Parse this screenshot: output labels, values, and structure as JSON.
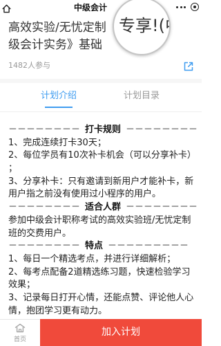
{
  "nav": {
    "title": "中级会计"
  },
  "magnifier": {
    "text": "专享!(中"
  },
  "course": {
    "title_lines": [
      "高效实验/无忧定制",
      "级会计实务》基础"
    ],
    "participants": "1482人参与"
  },
  "tabs": [
    {
      "label": "计划介绍",
      "active": true
    },
    {
      "label": "计划目录",
      "active": false
    }
  ],
  "content": {
    "rules_divider": {
      "left": "－－－－－－－－",
      "label": "打卡规则",
      "right": "－－－－－－－－"
    },
    "rules": [
      "1、完成连续打卡30天；",
      "2、每位学员有10次补卡机会（可以分享补卡）",
      "；",
      "3、分享补卡：只有邀请到新用户才能补卡，新",
      "用户指之前没有使用过小程序的用户。"
    ],
    "audience_divider": {
      "left": "－－－－－－－－",
      "label": "适合人群",
      "right": "－－－－－－－－"
    },
    "audience": [
      "参加中级会计职称考试的高效实验班/无忧定制",
      "班的交费用户。"
    ],
    "features_divider": {
      "left": "－－－－－－－－",
      "label": "特点",
      "right": "－－－－－－－－－"
    },
    "features": [
      "1、每日一个精选考点，并进行详细解析；",
      "2、每考点配备2道精选练习题，快速检验学习",
      "效果；",
      "3、记录每日打开心情，还能点赞、评论他人心",
      "情，抱团学习更有动力。"
    ]
  },
  "bottom_bar": {
    "home_label": "首页",
    "join_button_label": "加入计划"
  },
  "icons": {
    "nav_home": "home-icon",
    "more": "more-dots-icon",
    "capsule_close": "capsule-close-icon",
    "share": "share-icon",
    "tab_home": "home-icon"
  },
  "colors": {
    "accent": "#3f9cf0",
    "cta": "#f04a3b",
    "muted": "#999999",
    "text": "#222222"
  }
}
